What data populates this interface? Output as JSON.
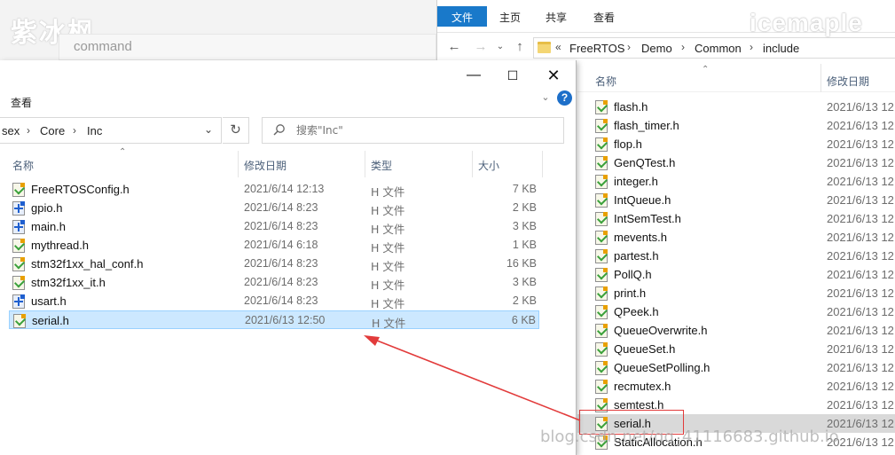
{
  "background_window": {
    "watermark": "紫冰枫",
    "command_text": "command"
  },
  "right_window": {
    "watermark": "icemaple",
    "ribbon_tabs": [
      "文件",
      "主页",
      "共享",
      "查看"
    ],
    "breadcrumb": [
      "FreeRTOS",
      "Demo",
      "Common",
      "include"
    ],
    "breadcrumb_prefix": "«",
    "columns": {
      "name": "名称",
      "date": "修改日期"
    },
    "files": [
      {
        "name": "flash.h",
        "date": "2021/6/13 12"
      },
      {
        "name": "flash_timer.h",
        "date": "2021/6/13 12"
      },
      {
        "name": "flop.h",
        "date": "2021/6/13 12"
      },
      {
        "name": "GenQTest.h",
        "date": "2021/6/13 12"
      },
      {
        "name": "integer.h",
        "date": "2021/6/13 12"
      },
      {
        "name": "IntQueue.h",
        "date": "2021/6/13 12"
      },
      {
        "name": "IntSemTest.h",
        "date": "2021/6/13 12"
      },
      {
        "name": "mevents.h",
        "date": "2021/6/13 12"
      },
      {
        "name": "partest.h",
        "date": "2021/6/13 12"
      },
      {
        "name": "PollQ.h",
        "date": "2021/6/13 12"
      },
      {
        "name": "print.h",
        "date": "2021/6/13 12"
      },
      {
        "name": "QPeek.h",
        "date": "2021/6/13 12"
      },
      {
        "name": "QueueOverwrite.h",
        "date": "2021/6/13 12"
      },
      {
        "name": "QueueSet.h",
        "date": "2021/6/13 12"
      },
      {
        "name": "QueueSetPolling.h",
        "date": "2021/6/13 12"
      },
      {
        "name": "recmutex.h",
        "date": "2021/6/13 12"
      },
      {
        "name": "semtest.h",
        "date": "2021/6/13 12"
      },
      {
        "name": "serial.h",
        "date": "2021/6/13 12",
        "selected": true
      },
      {
        "name": "StaticAllocation.h",
        "date": "2021/6/13 12"
      }
    ]
  },
  "front_window": {
    "ribbon_tab": "查看",
    "breadcrumb": [
      "sex",
      "Core",
      "Inc"
    ],
    "search_placeholder": "搜索\"Inc\"",
    "columns": {
      "name": "名称",
      "date": "修改日期",
      "type": "类型",
      "size": "大小"
    },
    "files": [
      {
        "name": "FreeRTOSConfig.h",
        "date": "2021/6/14 12:13",
        "type": "H 文件",
        "size": "7 KB",
        "icon": "h-file-icon"
      },
      {
        "name": "gpio.h",
        "date": "2021/6/14 8:23",
        "type": "H 文件",
        "size": "2 KB",
        "icon": "h-file-blue-icon"
      },
      {
        "name": "main.h",
        "date": "2021/6/14 8:23",
        "type": "H 文件",
        "size": "3 KB",
        "icon": "h-file-blue-icon"
      },
      {
        "name": "mythread.h",
        "date": "2021/6/14 6:18",
        "type": "H 文件",
        "size": "1 KB",
        "icon": "h-file-icon"
      },
      {
        "name": "stm32f1xx_hal_conf.h",
        "date": "2021/6/14 8:23",
        "type": "H 文件",
        "size": "16 KB",
        "icon": "h-file-icon"
      },
      {
        "name": "stm32f1xx_it.h",
        "date": "2021/6/14 8:23",
        "type": "H 文件",
        "size": "3 KB",
        "icon": "h-file-icon"
      },
      {
        "name": "usart.h",
        "date": "2021/6/14 8:23",
        "type": "H 文件",
        "size": "2 KB",
        "icon": "h-file-blue-icon"
      },
      {
        "name": "serial.h",
        "date": "2021/6/13 12:50",
        "type": "H 文件",
        "size": "6 KB",
        "icon": "h-file-icon",
        "selected": true
      }
    ]
  },
  "annotation": {
    "arrow_color": "#e23b3b",
    "blog_watermark": "blog.csdn.net/qq_41116683.github.io"
  },
  "colors": {
    "accent": "#1979ca",
    "selection_front": "#cce8ff",
    "selection_right": "#d9d9d9"
  }
}
